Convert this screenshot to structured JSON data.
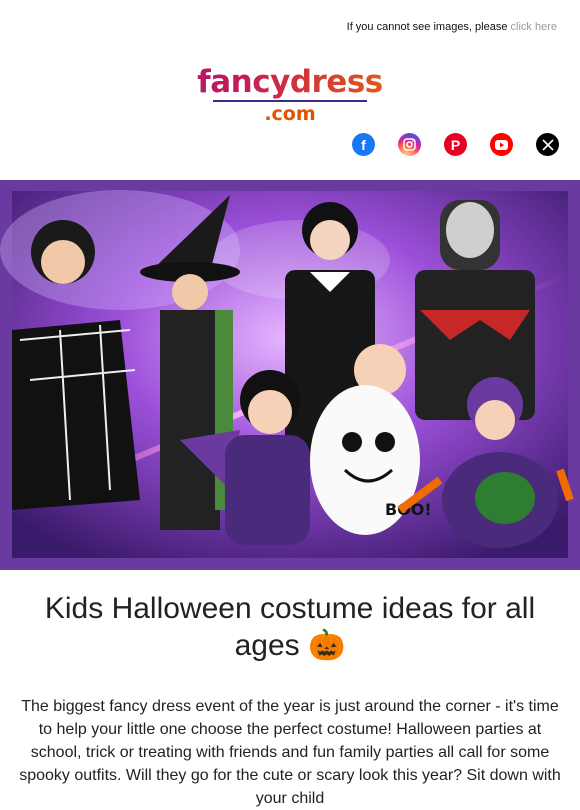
{
  "header": {
    "cannot_see_text": "If you cannot see images, please ",
    "click_here": "click here"
  },
  "logo": {
    "word": "fancydress",
    "domain": ".com"
  },
  "socials": [
    {
      "name": "facebook-icon",
      "glyph": "f"
    },
    {
      "name": "instagram-icon",
      "glyph": ""
    },
    {
      "name": "pinterest-icon",
      "glyph": "P"
    },
    {
      "name": "youtube-icon",
      "glyph": "▶"
    },
    {
      "name": "x-icon",
      "glyph": "𝕏"
    }
  ],
  "hero": {
    "ghost_label": "BOO!"
  },
  "content": {
    "title": "Kids Halloween costume ideas for all ages 🎃",
    "body": "The biggest fancy dress event of the year is just around the corner - it's time to help your little one choose the perfect costume! Halloween parties at school, trick or treating with friends and fun family parties all call for some spooky outfits. Will they go for the cute or scary look this year? Sit down with your child"
  },
  "colors": {
    "frame_purple": "#6a3aa0",
    "link_gray": "#9a9a9a"
  }
}
